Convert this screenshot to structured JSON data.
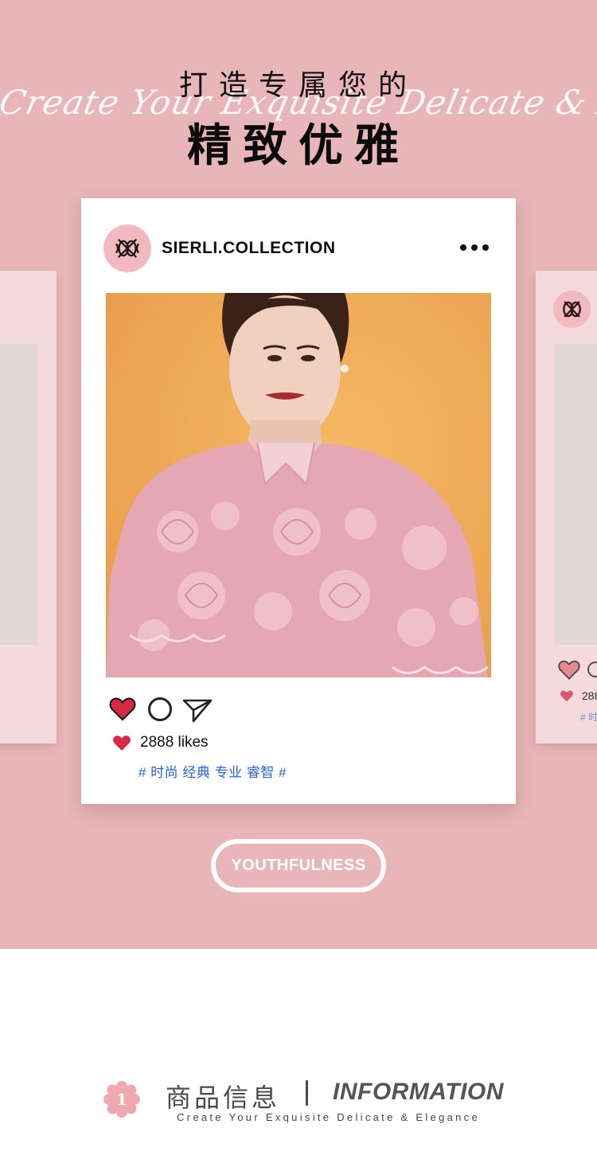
{
  "hero": {
    "title_cn": "打造专属您的",
    "title_cn_big": "精致优雅",
    "script_en": "Create Your Exquisite Delicate & Elegance"
  },
  "post": {
    "account": "SIERLI.COLLECTION",
    "more_icon": "more-horizontal-icon",
    "likes": "2888 likes",
    "tags": "# 时尚 经典 专业 睿智 #"
  },
  "side_post": {
    "likes_partial": "288",
    "tags_partial": "# 时"
  },
  "badge": {
    "label": "YOUTHFULNESS"
  },
  "info": {
    "number": "1",
    "title_cn": "商品信息",
    "title_en": "INFORMATION",
    "subtitle": "Create Your Exquisite Delicate & Elegance"
  },
  "colors": {
    "background_pink": "#e8b6b8",
    "heart_red": "#d42a45",
    "tag_blue": "#2c64c8",
    "avatar_pink": "#f2b9bf"
  }
}
